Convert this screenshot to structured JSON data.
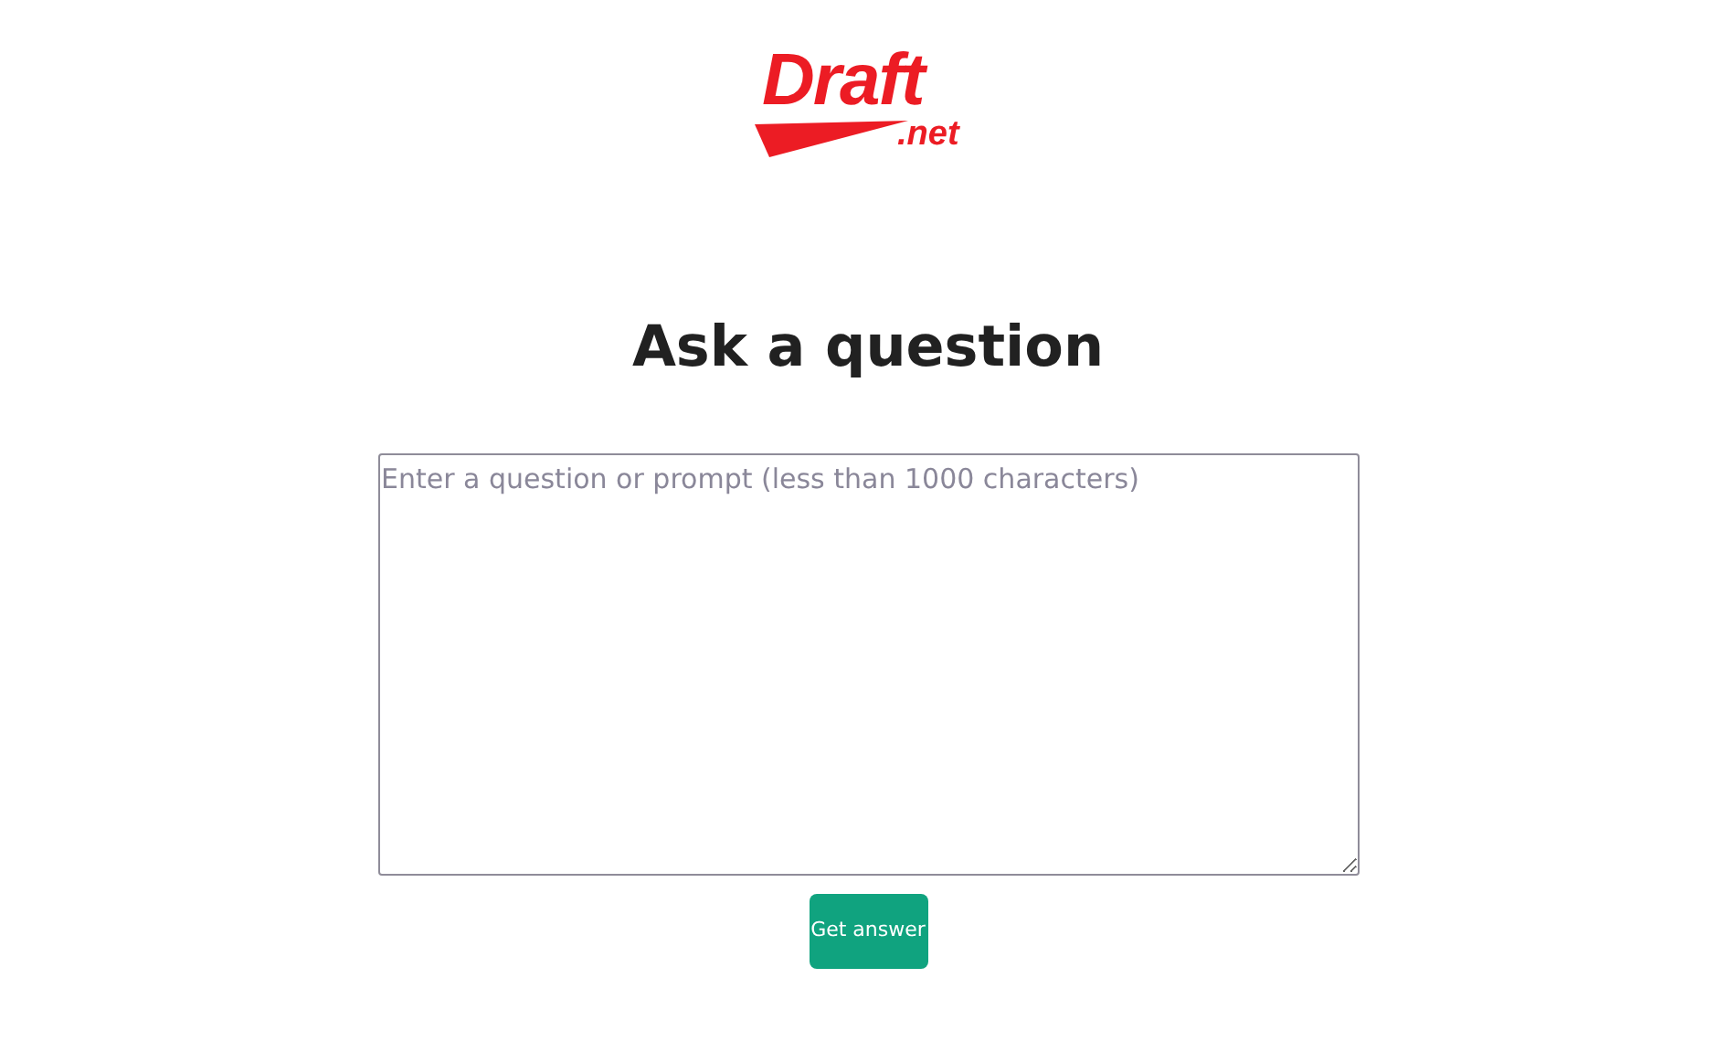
{
  "logo": {
    "name": "Draft",
    "suffix": ".net"
  },
  "heading": "Ask a question",
  "question": {
    "placeholder": "Enter a question or prompt (less than 1000 characters)"
  },
  "button": "Get answer"
}
